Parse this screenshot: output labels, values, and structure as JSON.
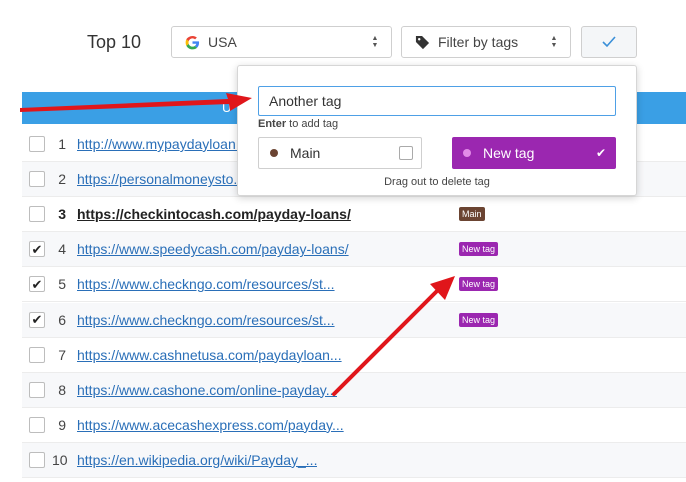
{
  "header": {
    "title": "Top 10",
    "country_select": {
      "value": "USA",
      "icon": "google-g-icon"
    },
    "tag_filter": {
      "placeholder": "Filter by tags",
      "icon": "tag-icon"
    },
    "apply_icon": "checkmark-icon"
  },
  "table": {
    "header_text": "U",
    "rows": [
      {
        "num": "1",
        "url": "http://www.mypaydayloan...",
        "checked": false,
        "tag": ""
      },
      {
        "num": "2",
        "url": "https://personalmoneysto...",
        "checked": false,
        "tag": ""
      },
      {
        "num": "3",
        "url": "https://checkintocash.com/payday-loans/",
        "checked": false,
        "tag": "Main",
        "bold": true
      },
      {
        "num": "4",
        "url": "https://www.speedycash.com/payday-loans/",
        "checked": true,
        "tag": "New tag"
      },
      {
        "num": "5",
        "url": "https://www.checkngo.com/resources/st...",
        "checked": true,
        "tag": "New tag"
      },
      {
        "num": "6",
        "url": "https://www.checkngo.com/resources/st...",
        "checked": true,
        "tag": "New tag"
      },
      {
        "num": "7",
        "url": "https://www.cashnetusa.com/paydayloan...",
        "checked": false,
        "tag": ""
      },
      {
        "num": "8",
        "url": "https://www.cashone.com/online-payday...",
        "checked": false,
        "tag": ""
      },
      {
        "num": "9",
        "url": "https://www.acecashexpress.com/payday...",
        "checked": false,
        "tag": ""
      },
      {
        "num": "10",
        "url": "https://en.wikipedia.org/wiki/Payday_...",
        "checked": false,
        "tag": ""
      }
    ]
  },
  "popup": {
    "input_value": "Another tag",
    "hint_key": "Enter",
    "hint_text": " to add tag",
    "tags": [
      {
        "label": "Main",
        "color": "#6b4432"
      },
      {
        "label": "New tag",
        "color": "#9b27b0"
      }
    ],
    "drag_hint": "Drag out to delete tag"
  },
  "colors": {
    "accent": "#3a9fe5",
    "link": "#2a6fb8",
    "tag_main": "#6b4432",
    "tag_new": "#9b27b0",
    "annotation_arrow": "#e0161b"
  }
}
